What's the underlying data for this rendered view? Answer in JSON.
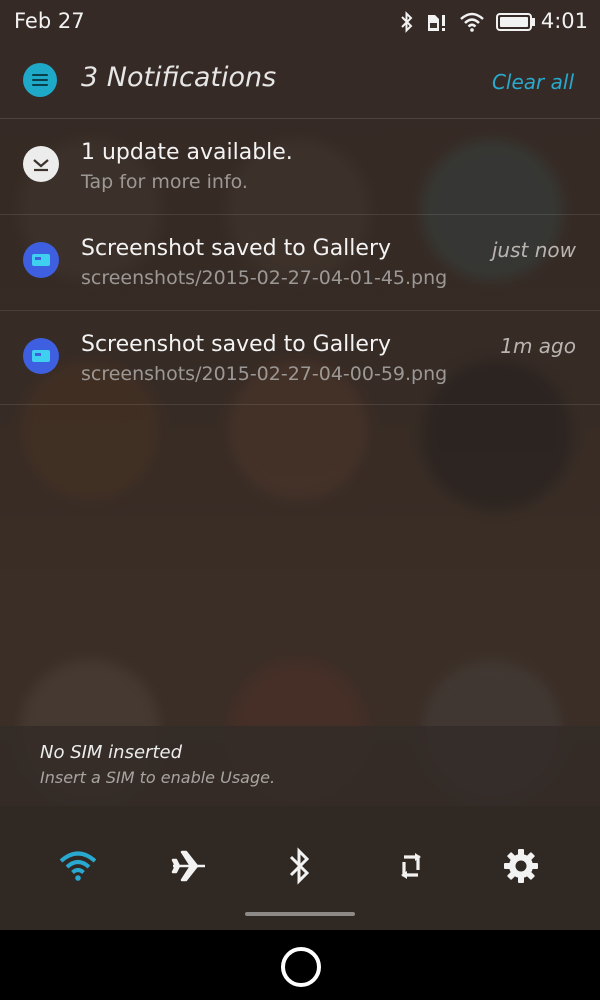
{
  "status_bar": {
    "date": "Feb 27",
    "time": "4:01",
    "icons": [
      "bluetooth-icon",
      "sim-alert-icon",
      "wifi-icon",
      "battery-icon"
    ]
  },
  "notifications": {
    "count_label": "3 Notifications",
    "clear_all_label": "Clear all",
    "items": [
      {
        "title": "1 update available.",
        "subtitle": "Tap for more info.",
        "time": "",
        "icon": "download-icon"
      },
      {
        "title": "Screenshot saved to Gallery",
        "subtitle": "screenshots/2015-02-27-04-01-45.png",
        "time": "just now",
        "icon": "gallery-icon"
      },
      {
        "title": "Screenshot saved to Gallery",
        "subtitle": "screenshots/2015-02-27-04-00-59.png",
        "time": "1m ago",
        "icon": "gallery-icon"
      }
    ]
  },
  "sim_notice": {
    "title": "No SIM inserted",
    "subtitle": "Insert a SIM to enable Usage."
  },
  "quick_settings": [
    {
      "name": "wifi-toggle",
      "icon": "wifi-icon",
      "active": true
    },
    {
      "name": "airplane-toggle",
      "icon": "airplane-icon",
      "active": false
    },
    {
      "name": "bluetooth-toggle",
      "icon": "bluetooth-icon",
      "active": false
    },
    {
      "name": "rotation-lock-toggle",
      "icon": "rotate-icon",
      "active": false
    },
    {
      "name": "settings-button",
      "icon": "gear-icon",
      "active": false
    }
  ],
  "colors": {
    "accent": "#29a9cf",
    "notification_icon_blue": "#3d5fe0",
    "background": "#3b312d"
  }
}
